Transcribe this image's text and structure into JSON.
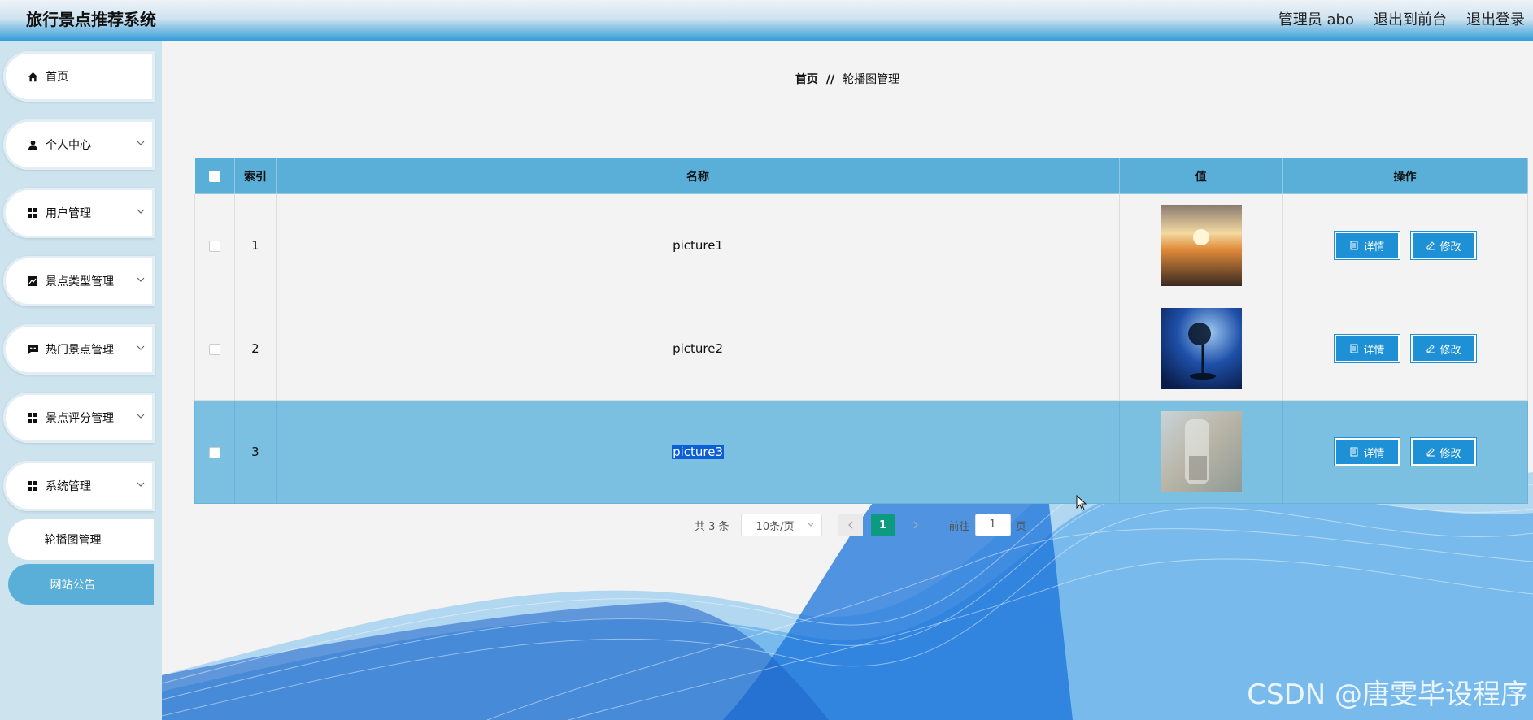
{
  "header": {
    "title": "旅行景点推荐系统",
    "admin": "管理员 abo",
    "to_front": "退出到前台",
    "logout": "退出登录"
  },
  "sidebar": {
    "items": [
      {
        "label": "首页",
        "icon": "home-icon"
      },
      {
        "label": "个人中心",
        "icon": "user-icon"
      },
      {
        "label": "用户管理",
        "icon": "grid-icon"
      },
      {
        "label": "景点类型管理",
        "icon": "chart-icon"
      },
      {
        "label": "热门景点管理",
        "icon": "chat-icon"
      },
      {
        "label": "景点评分管理",
        "icon": "grid-icon"
      },
      {
        "label": "系统管理",
        "icon": "grid-icon"
      }
    ],
    "sub_items": [
      {
        "label": "轮播图管理"
      },
      {
        "label": "网站公告",
        "active": true
      }
    ]
  },
  "breadcrumb": {
    "home": "首页",
    "sep": "//",
    "current": "轮播图管理"
  },
  "table": {
    "headers": {
      "index": "索引",
      "name": "名称",
      "value": "值",
      "actions": "操作"
    },
    "rows": [
      {
        "index": "1",
        "name": "picture1",
        "thumb": "sunset-field"
      },
      {
        "index": "2",
        "name": "picture2",
        "thumb": "blue-tree"
      },
      {
        "index": "3",
        "name": "picture3",
        "thumb": "glass-figure",
        "selected": true
      }
    ],
    "detail_label": "详情",
    "edit_label": "修改"
  },
  "pagination": {
    "total": "共 3 条",
    "page_size": "10条/页",
    "current": "1",
    "goto_prefix": "前往",
    "goto_value": "1",
    "goto_suffix": "页"
  },
  "watermark": "CSDN @唐雯毕设程序",
  "colors": {
    "accent": "#5aafd9",
    "button": "#1e91d6",
    "pager_active": "#0c9b7e",
    "selected_row": "#7bbfe1"
  }
}
